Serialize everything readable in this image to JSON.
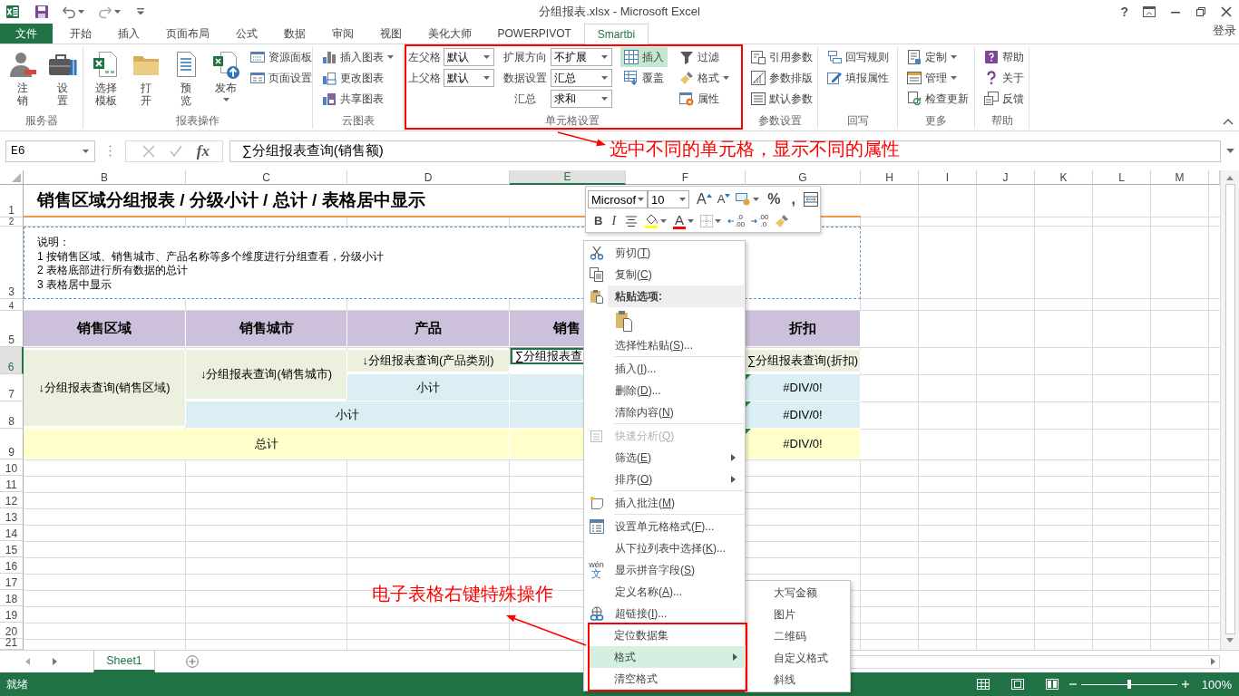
{
  "title_bar": {
    "title": "分组报表.xlsx - Microsoft Excel",
    "help": "?"
  },
  "ribbon_tabs": [
    {
      "label": "文件",
      "kind": "file",
      "selected": false
    },
    {
      "label": "开始",
      "kind": "tab",
      "selected": false
    },
    {
      "label": "插入",
      "kind": "tab",
      "selected": false
    },
    {
      "label": "页面布局",
      "kind": "tab",
      "selected": false
    },
    {
      "label": "公式",
      "kind": "tab",
      "selected": false
    },
    {
      "label": "数据",
      "kind": "tab",
      "selected": false
    },
    {
      "label": "审阅",
      "kind": "tab",
      "selected": false
    },
    {
      "label": "视图",
      "kind": "tab",
      "selected": false
    },
    {
      "label": "美化大师",
      "kind": "tab",
      "selected": false
    },
    {
      "label": "POWERPIVOT",
      "kind": "tab",
      "selected": false
    },
    {
      "label": "Smartbi",
      "kind": "tab",
      "selected": true
    }
  ],
  "account": "登录",
  "ribbon_groups": [
    {
      "label": "服务器",
      "columns": [
        [
          {
            "kind": "large",
            "lines": [
              "注",
              "销"
            ]
          }
        ],
        [
          {
            "kind": "large",
            "lines": [
              "设",
              "置"
            ]
          }
        ]
      ]
    },
    {
      "label": "报表操作",
      "columns": [
        [
          {
            "kind": "large",
            "lines": [
              "选择",
              "模板"
            ]
          }
        ],
        [
          {
            "kind": "large",
            "lines": [
              "打",
              "开"
            ]
          }
        ],
        [
          {
            "kind": "large",
            "lines": [
              "预",
              "览"
            ]
          }
        ],
        [
          {
            "kind": "large",
            "lines": [
              "发布"
            ],
            "dropdown": true
          }
        ],
        [
          {
            "kind": "small",
            "label": "资源面板"
          },
          {
            "kind": "small",
            "label": "页面设置"
          }
        ]
      ]
    },
    {
      "label": "云图表",
      "columns": [
        [
          {
            "kind": "small",
            "label": "插入图表",
            "dropdown": true
          },
          {
            "kind": "small",
            "label": "更改图表"
          },
          {
            "kind": "small",
            "label": "共享图表"
          }
        ]
      ]
    },
    {
      "label": "单元格设置",
      "columns": [
        [
          {
            "kind": "select",
            "label": "左父格",
            "value": "默认"
          },
          {
            "kind": "select",
            "label": "上父格",
            "value": "默认"
          }
        ],
        [
          {
            "kind": "select",
            "label": "扩展方向",
            "value": "不扩展"
          },
          {
            "kind": "select",
            "label": "数据设置",
            "value": "汇总"
          },
          {
            "kind": "select",
            "label": "汇总",
            "value": "求和"
          }
        ],
        [
          {
            "kind": "toggle",
            "label": "插入",
            "selected": true
          },
          {
            "kind": "toggle",
            "label": "覆盖",
            "selected": false
          }
        ],
        [
          {
            "kind": "small",
            "label": "过滤"
          },
          {
            "kind": "small",
            "label": "格式",
            "dropdown": true
          },
          {
            "kind": "small",
            "label": "属性"
          }
        ]
      ]
    },
    {
      "label": "参数设置",
      "columns": [
        [
          {
            "kind": "small",
            "label": "引用参数"
          },
          {
            "kind": "small",
            "label": "参数排版"
          },
          {
            "kind": "small",
            "label": "默认参数"
          }
        ]
      ]
    },
    {
      "label": "回写",
      "columns": [
        [
          {
            "kind": "small",
            "label": "回写规则"
          },
          {
            "kind": "small",
            "label": "填报属性"
          }
        ]
      ]
    },
    {
      "label": "更多",
      "columns": [
        [
          {
            "kind": "small",
            "label": "定制",
            "dropdown": true
          },
          {
            "kind": "small",
            "label": "管理",
            "dropdown": true
          },
          {
            "kind": "small",
            "label": "检查更新"
          }
        ]
      ]
    },
    {
      "label": "帮助",
      "columns": [
        [
          {
            "kind": "small",
            "label": "帮助"
          },
          {
            "kind": "small",
            "label": "关于"
          },
          {
            "kind": "small",
            "label": "反馈"
          }
        ]
      ]
    }
  ],
  "formula_bar": {
    "name_box": "E6",
    "function_button": "fx",
    "formula": "∑分组报表查询(销售额)"
  },
  "sheet": {
    "columns": [
      {
        "label": "B",
        "selected": false
      },
      {
        "label": "C",
        "selected": false
      },
      {
        "label": "D",
        "selected": false
      },
      {
        "label": "E",
        "selected": true
      },
      {
        "label": "F",
        "selected": false
      },
      {
        "label": "G",
        "selected": false
      },
      {
        "label": "H",
        "selected": false
      },
      {
        "label": "I",
        "selected": false
      },
      {
        "label": "J",
        "selected": false
      },
      {
        "label": "K",
        "selected": false
      },
      {
        "label": "L",
        "selected": false
      },
      {
        "label": "M",
        "selected": false
      }
    ],
    "rows": [
      {
        "label": "1",
        "selected": false
      },
      {
        "label": "2",
        "selected": false
      },
      {
        "label": "3",
        "selected": false
      },
      {
        "label": "4",
        "selected": false
      },
      {
        "label": "5",
        "selected": false
      },
      {
        "label": "6",
        "selected": true
      },
      {
        "label": "7",
        "selected": false
      },
      {
        "label": "8",
        "selected": false
      },
      {
        "label": "9",
        "selected": false
      },
      {
        "label": "10",
        "selected": false
      },
      {
        "label": "11",
        "selected": false
      },
      {
        "label": "12",
        "selected": false
      },
      {
        "label": "13",
        "selected": false
      },
      {
        "label": "14",
        "selected": false
      },
      {
        "label": "15",
        "selected": false
      },
      {
        "label": "16",
        "selected": false
      },
      {
        "label": "17",
        "selected": false
      },
      {
        "label": "18",
        "selected": false
      },
      {
        "label": "19",
        "selected": false
      },
      {
        "label": "20",
        "selected": false
      },
      {
        "label": "21",
        "selected": false
      }
    ],
    "title": "销售区域分组报表 / 分级小计 / 总计 / 表格居中显示",
    "notes": [
      "说明：",
      "1 按销售区域、销售城市、产品名称等多个维度进行分组查看，分级小计",
      "2 表格底部进行所有数据的总计",
      "3 表格居中显示"
    ],
    "header": [
      "销售区域",
      "销售城市",
      "产品",
      "销售",
      "折扣"
    ],
    "cells": [
      {
        "text": "↓分组报表查询(销售区域)",
        "kind": "group",
        "selected": false,
        "flagged": false
      },
      {
        "text": "↓分组报表查询(销售城市)",
        "kind": "group",
        "selected": false,
        "flagged": false
      },
      {
        "text": "↓分组报表查询(产品类别)",
        "kind": "group",
        "selected": false,
        "flagged": false
      },
      {
        "text": "∑分组报表查",
        "kind": "plain",
        "selected": true,
        "flagged": false
      },
      {
        "text": "∑分组报表查询(折扣)",
        "kind": "group",
        "selected": false,
        "flagged": false
      },
      {
        "text": "小计",
        "kind": "subtotal",
        "selected": false,
        "flagged": false
      },
      {
        "kind": "subtotal",
        "selected": false,
        "flagged": false
      },
      {
        "text": "#DIV/0!",
        "kind": "subtotal",
        "selected": false,
        "flagged": true
      },
      {
        "text": "小计",
        "kind": "subtotal",
        "selected": false,
        "flagged": false
      },
      {
        "kind": "subtotal",
        "selected": false,
        "flagged": false
      },
      {
        "text": "#DIV/0!",
        "kind": "subtotal",
        "selected": false,
        "flagged": true
      },
      {
        "text": "总计",
        "kind": "total",
        "selected": false,
        "flagged": false
      },
      {
        "kind": "total",
        "selected": false,
        "flagged": false
      },
      {
        "text": "#DIV/0!",
        "kind": "total",
        "selected": false,
        "flagged": true
      }
    ]
  },
  "sheet_tabs": [
    {
      "label": "Sheet1",
      "selected": true
    }
  ],
  "status_bar": {
    "status": "就绪",
    "zoom": {
      "level": 0.5,
      "label": "100%"
    }
  },
  "mini_toolbar": {
    "font": "Microsof",
    "size": "10",
    "row1": [
      {
        "kind": "grow",
        "glyph": "A"
      },
      {
        "kind": "shrink",
        "glyph": "A"
      },
      {
        "kind": "accounting"
      },
      {
        "kind": "glyph",
        "glyph": "%"
      },
      {
        "kind": "glyph",
        "glyph": ","
      },
      {
        "kind": "wrap"
      }
    ],
    "row2": [
      {
        "kind": "bold",
        "glyph": "B"
      },
      {
        "kind": "italic",
        "glyph": "I"
      },
      {
        "kind": "align"
      },
      {
        "kind": "fill",
        "color": "#ffff00"
      },
      {
        "kind": "font-color",
        "glyph": "A",
        "color": "#ff0000"
      },
      {
        "kind": "border"
      },
      {
        "kind": "decimal-more",
        "lines": [
          ".0",
          ".00"
        ]
      },
      {
        "kind": "decimal-less",
        "lines": [
          ".00",
          ".0"
        ]
      },
      {
        "kind": "painter"
      }
    ]
  },
  "context_menu": {
    "items": [
      {
        "kind": "item",
        "label": "剪切(",
        "key": "T",
        "after": ")",
        "disabled": false,
        "selected": false
      },
      {
        "kind": "item",
        "label": "复制(",
        "key": "C",
        "after": ")",
        "disabled": false,
        "selected": false
      },
      {
        "kind": "header",
        "label": "粘贴选项:"
      },
      {
        "kind": "paste-options"
      },
      {
        "kind": "item",
        "label": "选择性粘贴(",
        "key": "S",
        "after": ")...",
        "disabled": false,
        "selected": false
      },
      {
        "kind": "item",
        "label": "插入(",
        "key": "I",
        "after": ")...",
        "disabled": false,
        "selected": false,
        "separator_before": true
      },
      {
        "kind": "item",
        "label": "删除(",
        "key": "D",
        "after": ")...",
        "disabled": false,
        "selected": false
      },
      {
        "kind": "item",
        "label": "清除内容(",
        "key": "N",
        "after": ")",
        "disabled": false,
        "selected": false
      },
      {
        "kind": "item",
        "label": "快速分析(",
        "key": "Q",
        "after": ")",
        "disabled": true,
        "selected": false,
        "separator_before": true
      },
      {
        "kind": "item",
        "label": "筛选(",
        "key": "E",
        "after": ")",
        "disabled": false,
        "selected": false,
        "submenu": true
      },
      {
        "kind": "item",
        "label": "排序(",
        "key": "O",
        "after": ")",
        "disabled": false,
        "selected": false,
        "submenu": true
      },
      {
        "kind": "item",
        "label": "插入批注(",
        "key": "M",
        "after": ")",
        "disabled": false,
        "selected": false,
        "separator_before": true
      },
      {
        "kind": "item",
        "label": "设置单元格格式(",
        "key": "F",
        "after": ")...",
        "disabled": false,
        "selected": false,
        "separator_before": true
      },
      {
        "kind": "item",
        "label": "从下拉列表中选择(",
        "key": "K",
        "after": ")...",
        "disabled": false,
        "selected": false
      },
      {
        "kind": "item",
        "label": "显示拼音字段(",
        "key": "S",
        "after": ")",
        "disabled": false,
        "selected": false,
        "glyph_lines": [
          "wén",
          "文"
        ]
      },
      {
        "kind": "item",
        "label": "定义名称(",
        "key": "A",
        "after": ")...",
        "disabled": false,
        "selected": false
      },
      {
        "kind": "item",
        "label": "超链接(",
        "key": "I",
        "after": ")...",
        "disabled": false,
        "selected": false
      },
      {
        "kind": "item",
        "label": "定位数据集",
        "disabled": false,
        "selected": false
      },
      {
        "kind": "item",
        "label": "格式",
        "disabled": false,
        "selected": true,
        "submenu": true
      },
      {
        "kind": "item",
        "label": "清空格式",
        "disabled": false,
        "selected": false
      }
    ]
  },
  "submenu": {
    "items": [
      {
        "label": "大写金额"
      },
      {
        "label": "图片"
      },
      {
        "label": "二维码"
      },
      {
        "label": "自定义格式"
      },
      {
        "label": "斜线"
      }
    ]
  },
  "annotations": [
    {
      "text": "选中不同的单元格，显示不同的属性"
    },
    {
      "text": "电子表格右键特殊操作"
    }
  ]
}
